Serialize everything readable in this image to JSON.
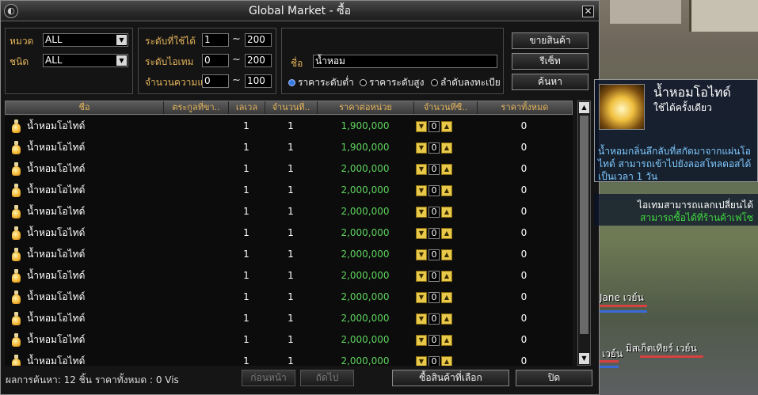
{
  "window": {
    "title": "Global Market - ซื้อ",
    "close": "✕"
  },
  "filters": {
    "category_label": "หมวด",
    "category_value": "ALL",
    "type_label": "ชนิด",
    "type_value": "ALL",
    "usable_level_label": "ระดับที่ใช้ได้",
    "usable_level_min": "1",
    "usable_level_max": "200",
    "item_level_label": "ระดับไอเทม",
    "item_level_min": "0",
    "item_level_max": "200",
    "durability_label": "จำนวนความแ",
    "durability_min": "0",
    "durability_max": "100",
    "tilde": "~"
  },
  "search": {
    "name_label": "ชื่อ",
    "name_value": "น้ำหอม",
    "sort_options": [
      "ราคาระดับต่ำ",
      "ราคาระดับสูง",
      "ลำดับลงทะเบีย"
    ],
    "sort_selected": 0
  },
  "buttons": {
    "sell": "ขายสินค้า",
    "reset": "รีเซ็ท",
    "search": "ค้นหา",
    "prev": "ก่อนหน้า",
    "next": "ถัดไป",
    "buy_selected": "ซื้อสินค้าที่เลือก",
    "close": "ปิด"
  },
  "table": {
    "columns": [
      "ชื่อ",
      "ตระกูลที่ขา..",
      "เลเวล",
      "จำนวนที่..",
      "ราคาต่อหน่วย",
      "จำนวนที่ซื..",
      "ราคาทั้งหมด"
    ],
    "rows": [
      {
        "name": "น้ำหอมโอไทด์",
        "level": "1",
        "count": "1",
        "price": "1,900,000",
        "buy_qty": "0",
        "total": "0"
      },
      {
        "name": "น้ำหอมโอไทด์",
        "level": "1",
        "count": "1",
        "price": "1,900,000",
        "buy_qty": "0",
        "total": "0"
      },
      {
        "name": "น้ำหอมโอไทด์",
        "level": "1",
        "count": "1",
        "price": "2,000,000",
        "buy_qty": "0",
        "total": "0"
      },
      {
        "name": "น้ำหอมโอไทด์",
        "level": "1",
        "count": "1",
        "price": "2,000,000",
        "buy_qty": "0",
        "total": "0"
      },
      {
        "name": "น้ำหอมโอไทด์",
        "level": "1",
        "count": "1",
        "price": "2,000,000",
        "buy_qty": "0",
        "total": "0"
      },
      {
        "name": "น้ำหอมโอไทด์",
        "level": "1",
        "count": "1",
        "price": "2,000,000",
        "buy_qty": "0",
        "total": "0"
      },
      {
        "name": "น้ำหอมโอไทด์",
        "level": "1",
        "count": "1",
        "price": "2,000,000",
        "buy_qty": "0",
        "total": "0"
      },
      {
        "name": "น้ำหอมโอไทด์",
        "level": "1",
        "count": "1",
        "price": "2,000,000",
        "buy_qty": "0",
        "total": "0"
      },
      {
        "name": "น้ำหอมโอไทด์",
        "level": "1",
        "count": "1",
        "price": "2,000,000",
        "buy_qty": "0",
        "total": "0"
      },
      {
        "name": "น้ำหอมโอไทด์",
        "level": "1",
        "count": "1",
        "price": "2,000,000",
        "buy_qty": "0",
        "total": "0"
      },
      {
        "name": "น้ำหอมโอไทด์",
        "level": "1",
        "count": "1",
        "price": "2,000,000",
        "buy_qty": "0",
        "total": "0"
      },
      {
        "name": "น้ำหอมโอไทด์",
        "level": "1",
        "count": "1",
        "price": "2,000,000",
        "buy_qty": "0",
        "total": "0"
      }
    ]
  },
  "status": "ผลการค้นหา: 12 ชิ้น  ราคาทั้งหมด : 0 Vis",
  "tooltip": {
    "name": "น้ำหอมโอไทด์",
    "sub": "ใช้ได้ครั้งเดียว",
    "desc": "น้ำหอมกลิ่นลึกลับที่สกัดมาจากแผ่นโอไทด์ สามารถเข้าไปยังลอสโทลดอสได้เป็นเวลา 1 วัน",
    "note1": "ไอเทมสามารถแลกเปลี่ยนได้",
    "note2": "สามารถซื้อได้ที่ร้านค้าเฟโซ"
  },
  "scene": {
    "char1": "Jane เวย์น",
    "char2": "มิสเก็ตเทียร์ เวย์น",
    "char3": "เวย์น"
  }
}
